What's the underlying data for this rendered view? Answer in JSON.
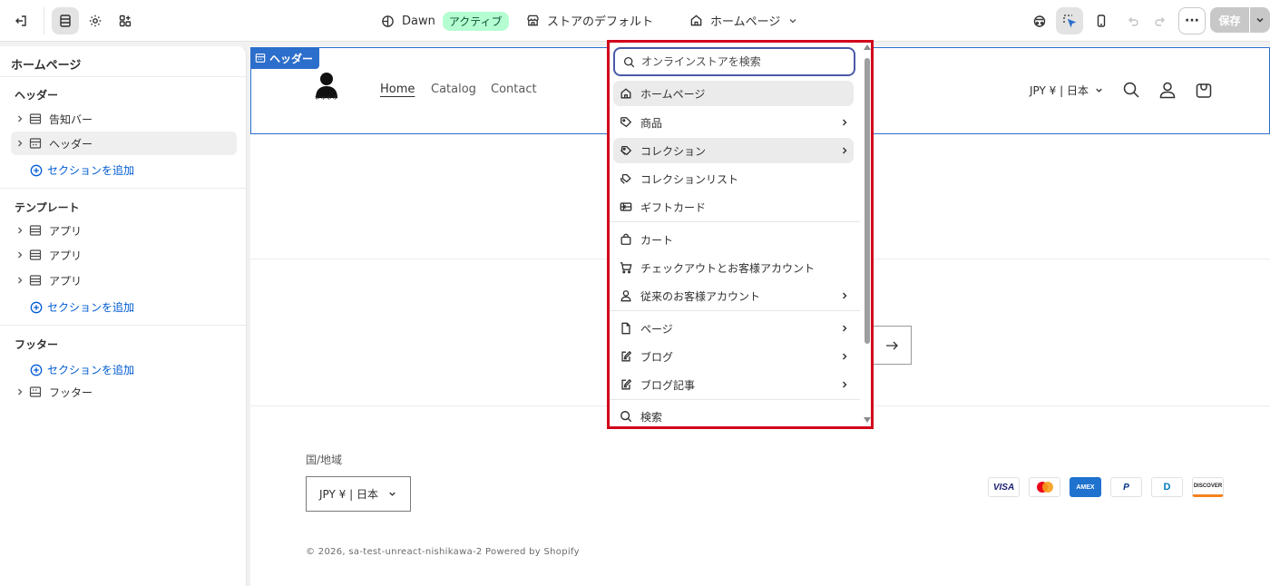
{
  "topbar": {
    "theme_name": "Dawn",
    "theme_status": "アクティブ",
    "store_default": "ストアのデフォルト",
    "page_selector": "ホームページ",
    "save_label": "保存",
    "more_label": "···"
  },
  "sidebar": {
    "title": "ホームページ",
    "groups": [
      {
        "heading": "ヘッダー",
        "items": [
          "告知バー",
          "ヘッダー"
        ],
        "add_label": "セクションを追加"
      },
      {
        "heading": "テンプレート",
        "items": [
          "アプリ",
          "アプリ",
          "アプリ"
        ],
        "add_label": "セクションを追加"
      },
      {
        "heading": "フッター",
        "items": [
          "フッター"
        ],
        "add_label": "セクションを追加"
      }
    ]
  },
  "canvas": {
    "header_tag": "ヘッダー",
    "logo_text": "****",
    "nav": [
      "Home",
      "Catalog",
      "Contact"
    ],
    "locale": "JPY ¥ | 日本",
    "footer_label": "国/地域",
    "footer_select": "JPY ¥ | 日本",
    "payments": [
      "VISA",
      "MC",
      "AMEX",
      "P",
      "D",
      "DISCOVER"
    ],
    "copyright": "© 2026, sa-test-unreact-nishikawa-2 Powered by Shopify"
  },
  "dropdown": {
    "search_placeholder": "オンラインストアを検索",
    "items": [
      {
        "label": "ホームページ",
        "icon": "home-icon"
      },
      {
        "label": "商品",
        "icon": "tag-icon"
      },
      {
        "label": "コレクション",
        "icon": "collection-icon"
      },
      {
        "label": "コレクションリスト",
        "icon": "collection-list-icon"
      },
      {
        "label": "ギフトカード",
        "icon": "gift-card-icon"
      },
      {
        "label": "カート",
        "icon": "bag-icon"
      },
      {
        "label": "チェックアウトとお客様アカウント",
        "icon": "cart-icon"
      },
      {
        "label": "従来のお客様アカウント",
        "icon": "person-icon"
      },
      {
        "label": "ページ",
        "icon": "page-icon"
      },
      {
        "label": "ブログ",
        "icon": "blog-icon"
      },
      {
        "label": "ブログ記事",
        "icon": "blog-post-icon"
      },
      {
        "label": "検索",
        "icon": "search-icon"
      }
    ]
  },
  "colors": {
    "accent": "#2c6ecb",
    "highlight_border": "#d0021b",
    "link": "#005bd3",
    "active_badge": "#b4fed2"
  }
}
